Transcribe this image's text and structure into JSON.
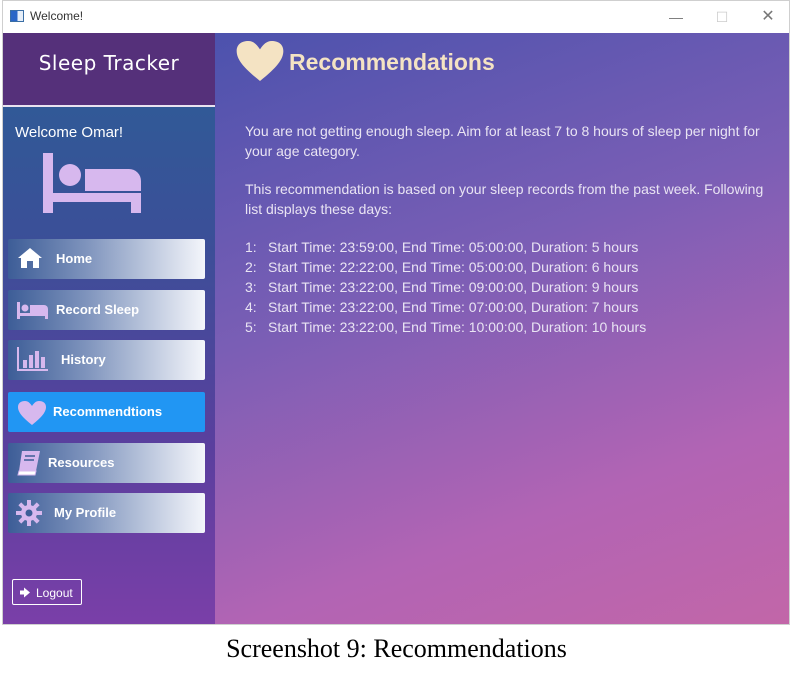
{
  "window": {
    "title": "Welcome!",
    "controls": {
      "minimize": "—",
      "maximize": "☐",
      "close": "✕"
    }
  },
  "sidebar": {
    "brand": "Sleep Tracker",
    "welcome": "Welcome Omar!",
    "nav": [
      {
        "label": "Home",
        "icon": "home-icon"
      },
      {
        "label": "Record Sleep",
        "icon": "bed-icon"
      },
      {
        "label": "History",
        "icon": "bar-chart-icon"
      },
      {
        "label": "Recommendtions",
        "icon": "heart-icon",
        "active": true
      },
      {
        "label": "Resources",
        "icon": "book-icon"
      },
      {
        "label": "My Profile",
        "icon": "gear-icon"
      }
    ],
    "logout": "Logout"
  },
  "main": {
    "title": "Recommendations",
    "paragraph1": "You are not getting enough sleep. Aim for at least 7 to 8 hours of sleep per night for your age category.",
    "paragraph2": "This recommendation is based on your sleep records from the past week. Following list displays these days:",
    "records": [
      {
        "num": "1:",
        "text": "Start Time: 23:59:00, End Time: 05:00:00, Duration: 5 hours"
      },
      {
        "num": "2:",
        "text": "Start Time: 22:22:00, End Time: 05:00:00, Duration: 6 hours"
      },
      {
        "num": "3:",
        "text": "Start Time: 23:22:00, End Time: 09:00:00, Duration: 9 hours"
      },
      {
        "num": "4:",
        "text": "Start Time: 23:22:00, End Time: 07:00:00, Duration: 7 hours"
      },
      {
        "num": "5:",
        "text": "Start Time: 23:22:00, End Time: 10:00:00, Duration: 10 hours"
      }
    ]
  },
  "caption": "Screenshot 9: Recommendations",
  "colors": {
    "accent": "#2196f3",
    "icon": "#d7b8ee",
    "title": "#f4e3c3"
  }
}
